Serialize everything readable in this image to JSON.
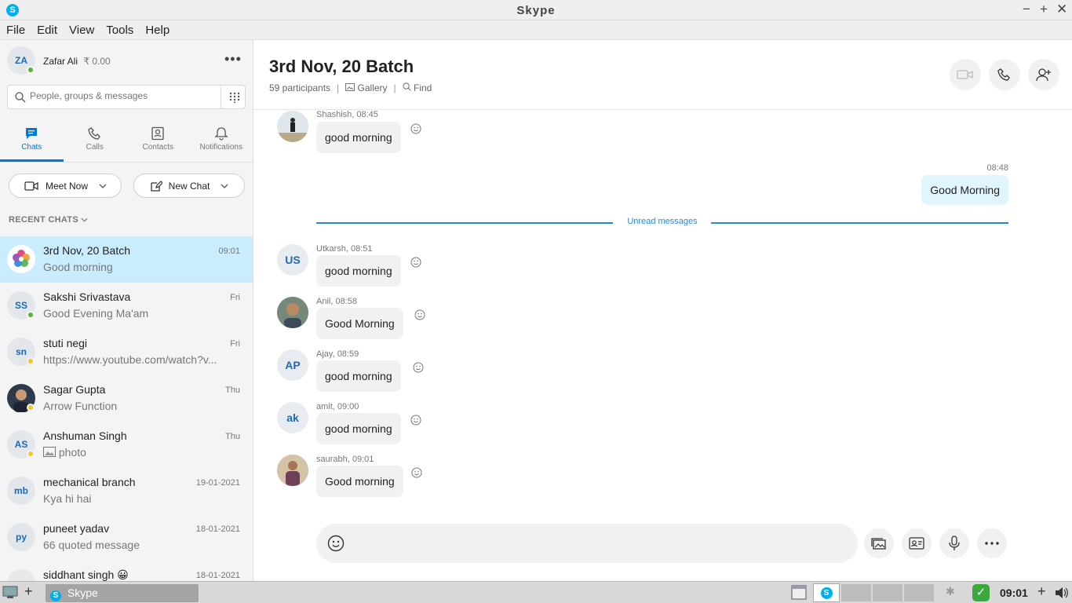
{
  "window": {
    "title": "Skype",
    "buttons": {
      "minimize": "−",
      "maximize": "+",
      "close": "✕"
    }
  },
  "menu": [
    "File",
    "Edit",
    "View",
    "Tools",
    "Help"
  ],
  "profile": {
    "initials": "ZA",
    "name": "Zafar Ali",
    "credit": "₹ 0.00",
    "more": "•••"
  },
  "search": {
    "placeholder": "People, groups & messages"
  },
  "nav": {
    "chats": "Chats",
    "calls": "Calls",
    "contacts": "Contacts",
    "notifications": "Notifications"
  },
  "actions": {
    "meet_now": "Meet Now",
    "new_chat": "New Chat"
  },
  "recent_header": "RECENT CHATS",
  "chats": [
    {
      "name": "3rd Nov, 20 Batch",
      "preview": "Good morning",
      "date": "09:01",
      "initials": "",
      "status": ""
    },
    {
      "name": "Sakshi Srivastava",
      "preview": "Good Evening Ma'am",
      "date": "Fri",
      "initials": "SS",
      "status": "online"
    },
    {
      "name": "stuti negi",
      "preview": "https://www.youtube.com/watch?v...",
      "date": "Fri",
      "initials": "sn",
      "status": "away"
    },
    {
      "name": "Sagar Gupta",
      "preview": "Arrow Function",
      "date": "Thu",
      "initials": "",
      "status": "away"
    },
    {
      "name": "Anshuman Singh",
      "preview": "photo",
      "date": "Thu",
      "initials": "AS",
      "status": "away"
    },
    {
      "name": "mechanical branch",
      "preview": "Kya hi hai",
      "date": "19-01-2021",
      "initials": "mb",
      "status": ""
    },
    {
      "name": "puneet yadav",
      "preview": "66 quoted message",
      "date": "18-01-2021",
      "initials": "py",
      "status": ""
    },
    {
      "name": "siddhant singh 😀",
      "preview": "",
      "date": "18-01-2021",
      "initials": "",
      "status": ""
    }
  ],
  "conversation": {
    "title": "3rd Nov, 20 Batch",
    "participants": "59 participants",
    "gallery": "Gallery",
    "find": "Find",
    "own_time": "08:48",
    "own_message": "Good Morning",
    "unread_label": "Unread messages",
    "messages": [
      {
        "sender": "Shashish, 08:45",
        "text": "good morning",
        "initials": ""
      },
      {
        "sender": "Utkarsh, 08:51",
        "text": "good morning",
        "initials": "US"
      },
      {
        "sender": "Anil, 08:58",
        "text": "Good Morning",
        "initials": ""
      },
      {
        "sender": "Ajay, 08:59",
        "text": "good morning",
        "initials": "AP"
      },
      {
        "sender": "amit, 09:00",
        "text": "good morning",
        "initials": "ak"
      },
      {
        "sender": "saurabh, 09:01",
        "text": "Good morning",
        "initials": ""
      }
    ]
  },
  "colors": {
    "accent": "#0078d4",
    "selected": "#c9ecff",
    "online": "#5bb431",
    "away": "#f8c327",
    "unread": "#2b88d8"
  },
  "taskbar": {
    "task": "Skype",
    "clock": "09:01"
  }
}
